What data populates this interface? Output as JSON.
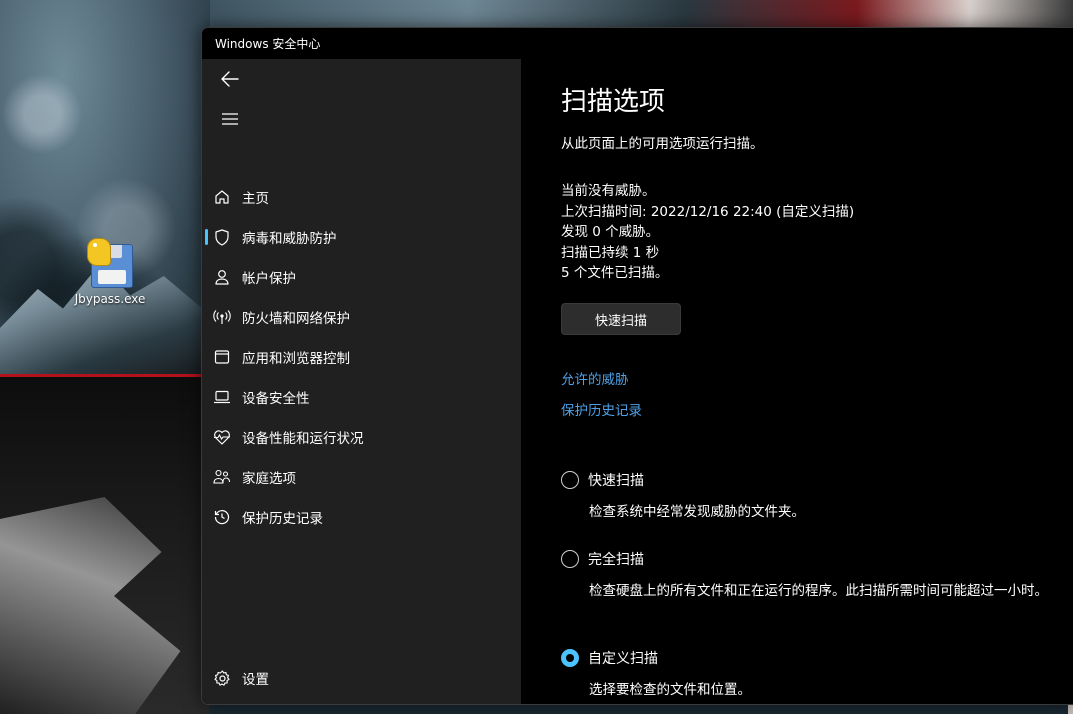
{
  "desktop": {
    "icon_label": "Jbypass.exe"
  },
  "window": {
    "title": "Windows 安全中心"
  },
  "sidebar": {
    "items": [
      {
        "label": "主页",
        "icon": "home-icon"
      },
      {
        "label": "病毒和威胁防护",
        "icon": "shield-icon",
        "active": true
      },
      {
        "label": "帐户保护",
        "icon": "person-icon"
      },
      {
        "label": "防火墙和网络保护",
        "icon": "antenna-icon"
      },
      {
        "label": "应用和浏览器控制",
        "icon": "app-window-icon"
      },
      {
        "label": "设备安全性",
        "icon": "laptop-icon"
      },
      {
        "label": "设备性能和运行状况",
        "icon": "heart-pulse-icon"
      },
      {
        "label": "家庭选项",
        "icon": "family-icon"
      },
      {
        "label": "保护历史记录",
        "icon": "history-icon"
      }
    ],
    "settings_label": "设置"
  },
  "main": {
    "title": "扫描选项",
    "subtitle": "从此页面上的可用选项运行扫描。",
    "status": {
      "threats": "当前没有威胁。",
      "last_scan": "上次扫描时间: 2022/12/16 22:40 (自定义扫描)",
      "found": "发现 0 个威胁。",
      "duration": "扫描已持续 1 秒",
      "files": "5 个文件已扫描。"
    },
    "quick_scan_button": "快速扫描",
    "links": {
      "allowed_threats": "允许的威胁",
      "protection_history": "保护历史记录"
    },
    "options": [
      {
        "label": "快速扫描",
        "description": "检查系统中经常发现威胁的文件夹。",
        "selected": false
      },
      {
        "label": "完全扫描",
        "description": "检查硬盘上的所有文件和正在运行的程序。此扫描所需时间可能超过一小时。",
        "selected": false
      },
      {
        "label": "自定义扫描",
        "description": "选择要检查的文件和位置。",
        "selected": true
      }
    ]
  },
  "colors": {
    "accent": "#4cc2ff",
    "link": "#4ea1e6",
    "sidebar_bg": "#202020",
    "content_bg": "#000000"
  }
}
